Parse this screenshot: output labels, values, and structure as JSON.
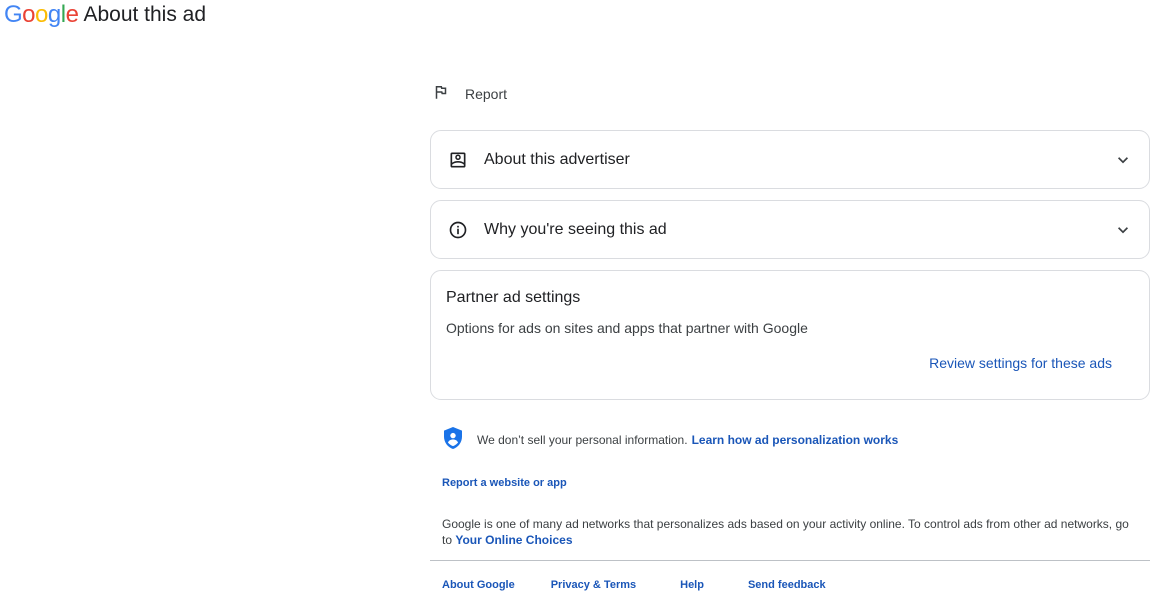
{
  "header": {
    "logo_letters": [
      {
        "char": "G",
        "color": "#4285F4"
      },
      {
        "char": "o",
        "color": "#EA4335"
      },
      {
        "char": "o",
        "color": "#FBBC05"
      },
      {
        "char": "g",
        "color": "#4285F4"
      },
      {
        "char": "l",
        "color": "#34A853"
      },
      {
        "char": "e",
        "color": "#EA4335"
      }
    ],
    "title": "About this ad"
  },
  "report": {
    "label": "Report",
    "icon": "flag-icon"
  },
  "accordions": [
    {
      "title": "About this advertiser",
      "icon": "advertiser-badge-icon"
    },
    {
      "title": "Why you're seeing this ad",
      "icon": "info-icon"
    }
  ],
  "partner": {
    "title": "Partner ad settings",
    "description": "Options for ads on sites and apps that partner with Google",
    "link": "Review settings for these ads"
  },
  "privacy": {
    "icon": "shield-user-icon",
    "text": "We don’t sell your personal information.",
    "link": "Learn how ad personalization works"
  },
  "report_site": "Report a website or app",
  "networks": {
    "text": "Google is one of many ad networks that personalizes ads based on your activity online. To control ads from other ad networks, go to",
    "link": "Your Online Choices"
  },
  "footer": {
    "links": [
      "About Google",
      "Privacy & Terms",
      "Help",
      "Send feedback"
    ]
  },
  "colors": {
    "link": "#1a56b8",
    "text": "#202124",
    "secondary_text": "#3c4043",
    "border": "#dadce0",
    "shield": "#1a73e8"
  }
}
